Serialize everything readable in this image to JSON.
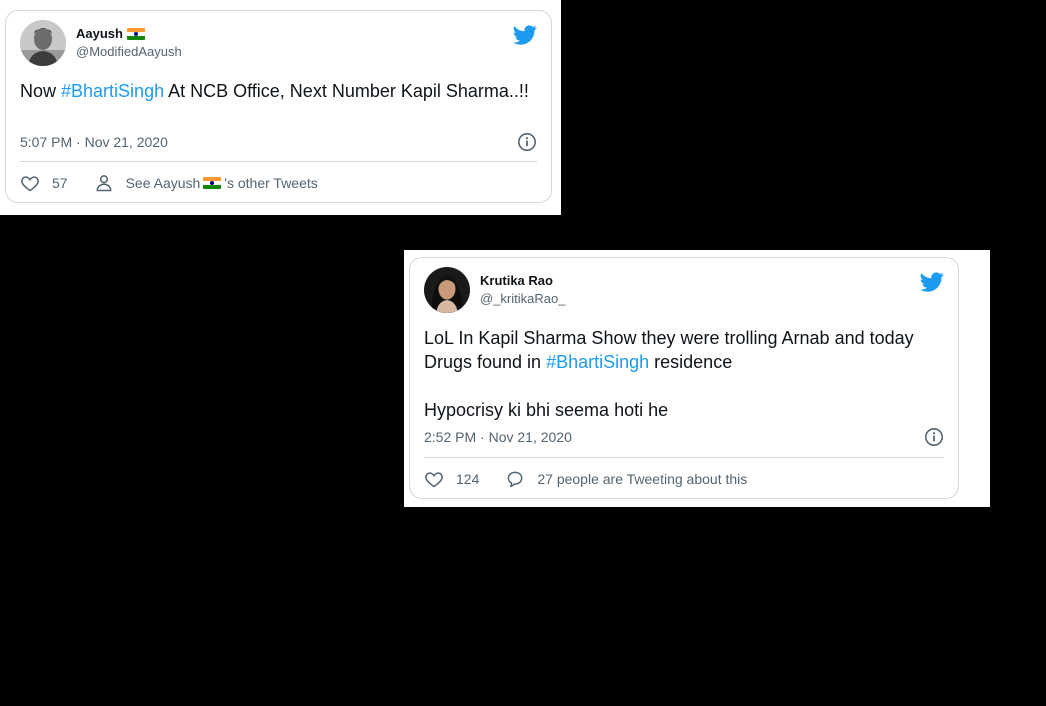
{
  "colors": {
    "background": "#000000",
    "card_border": "#cfd9de",
    "text_primary": "#0f1419",
    "text_secondary": "#536471",
    "hashtag": "#1d9bf0",
    "twitter_blue": "#1d9bf0"
  },
  "tweets": [
    {
      "author": {
        "name": "Aayush",
        "handle": "@ModifiedAayush",
        "name_flag": "india-flag-icon"
      },
      "text_before": "Now ",
      "hashtag": "#BhartiSingh",
      "text_after": " At NCB Office, Next Number Kapil Sharma..!!",
      "timestamp": "5:07 PM · Nov 21, 2020",
      "likes": "57",
      "secondary_action_prefix": "See Aayush",
      "secondary_action_suffix": "'s other Tweets",
      "secondary_icon": "person-icon"
    },
    {
      "author": {
        "name": "Krutika Rao",
        "handle": "@_kritikaRao_"
      },
      "text_before": "LoL In Kapil Sharma Show they were trolling Arnab and today Drugs found in ",
      "hashtag": "#BhartiSingh",
      "text_after": " residence",
      "text_para2": "Hypocrisy ki bhi seema hoti he",
      "timestamp": "2:52 PM · Nov 21, 2020",
      "likes": "124",
      "secondary_action_text": "27 people are Tweeting about this",
      "secondary_icon": "reply-bubble-icon"
    }
  ]
}
